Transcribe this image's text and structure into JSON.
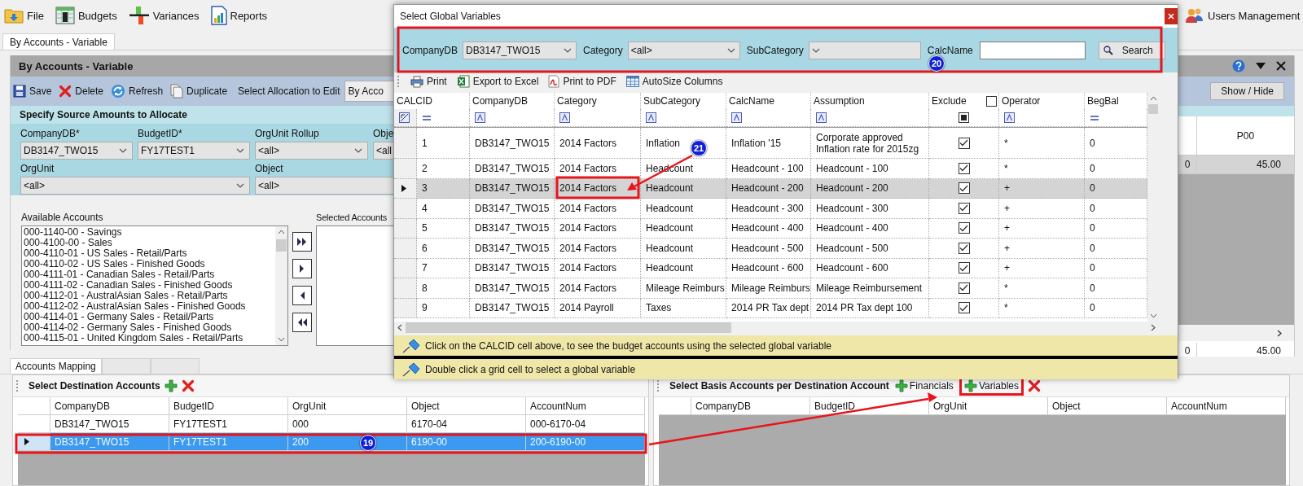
{
  "menu": {
    "items": [
      {
        "label": "File"
      },
      {
        "label": "Budgets"
      },
      {
        "label": "Variances"
      },
      {
        "label": "Reports"
      }
    ],
    "user_button": "Users Management"
  },
  "document_tabs": [
    {
      "label": "By Accounts - Variable",
      "selected": true
    }
  ],
  "panel": {
    "title": "By Accounts - Variable",
    "toolbar": {
      "buttons": [
        {
          "label": "Save"
        },
        {
          "label": "Delete"
        },
        {
          "label": "Refresh"
        },
        {
          "label": "Duplicate"
        }
      ],
      "allocation_label": "Select Allocation to Edit",
      "allocation_value": "By Acco",
      "show_hide": "Show / Hide"
    },
    "source_section": {
      "title": "Specify Source Amounts to Allocate",
      "fields": [
        {
          "label": "CompanyDB*",
          "value": "DB3147_TWO15"
        },
        {
          "label": "BudgetID*",
          "value": "FY17TEST1"
        },
        {
          "label": "OrgUnit Rollup",
          "value": "<all>"
        },
        {
          "label": "Obje",
          "value": "<all"
        },
        {
          "label": "OrgUnit",
          "value": "<all>"
        },
        {
          "label": "Object",
          "value": "<all>"
        }
      ]
    },
    "available_accounts": {
      "label": "Available Accounts",
      "items": [
        "000-1140-00 - Savings",
        "000-4100-00 - Sales",
        "000-4110-01 - US Sales - Retail/Parts",
        "000-4110-02 - US Sales - Finished Goods",
        "000-4111-01 - Canadian Sales - Retail/Parts",
        "000-4111-02 - Canadian Sales - Finished Goods",
        "000-4112-01 - AustralAsian Sales - Retail/Parts",
        "000-4112-02 - AustralAsian Sales - Finished Goods",
        "000-4114-01 - Germany Sales - Retail/Parts",
        "000-4114-02 - Germany Sales - Finished Goods",
        "000-4115-01 - United Kingdom Sales - Retail/Parts"
      ]
    },
    "selected_accounts": {
      "label": "Selected Accounts"
    },
    "amount_grid": {
      "column_header": "P00",
      "rows": [
        {
          "column_1": "0",
          "value": "45.00",
          "selected": true
        }
      ],
      "totals": {
        "column_1": "0",
        "value": "45.00"
      }
    }
  },
  "mapping_tabs": [
    {
      "label": "Accounts Mapping",
      "selected": true
    },
    {
      "selected": false
    },
    {
      "selected": false
    }
  ],
  "destination": {
    "title": "Select Destination Accounts",
    "columns": [
      "CompanyDB",
      "BudgetID",
      "OrgUnit",
      "Object",
      "AccountNum"
    ],
    "rows": [
      {
        "cells": [
          "DB3147_TWO15",
          "FY17TEST1",
          "000",
          "6170-04",
          "000-6170-04"
        ],
        "selected": false
      },
      {
        "cells": [
          "DB3147_TWO15",
          "FY17TEST1",
          "200",
          "6190-00",
          "200-6190-00"
        ],
        "selected": true
      }
    ]
  },
  "basis": {
    "title": "Select Basis Accounts per Destination Account",
    "add_buttons": [
      {
        "label": "Financials"
      },
      {
        "label": "Variables"
      }
    ],
    "columns": [
      "CompanyDB",
      "BudgetID",
      "OrgUnit",
      "Object",
      "AccountNum"
    ]
  },
  "dialog": {
    "title": "Select Global Variables",
    "filters": [
      {
        "label": "CompanyDB",
        "value": "DB3147_TWO15",
        "kind": "dropdown"
      },
      {
        "label": "Category",
        "value": "<all>",
        "kind": "dropdown"
      },
      {
        "label": "SubCategory",
        "kind": "dropdown"
      },
      {
        "label": "CalcName",
        "kind": "text"
      }
    ],
    "search_button": "Search",
    "toolbar": [
      {
        "label": "Print"
      },
      {
        "label": "Export to Excel"
      },
      {
        "label": "Print to PDF"
      },
      {
        "label": "AutoSize Columns"
      }
    ],
    "grid": {
      "columns": [
        {
          "label": "CALCID",
          "kind": "equals"
        },
        {
          "label": "CompanyDB",
          "kind": "text"
        },
        {
          "label": "Category",
          "kind": "text"
        },
        {
          "label": "SubCategory",
          "kind": "text"
        },
        {
          "label": "CalcName",
          "kind": "text"
        },
        {
          "label": "Assumption",
          "kind": "text"
        },
        {
          "label": "Exclude",
          "kind": "check"
        },
        {
          "label": "Operator",
          "kind": "text"
        },
        {
          "label": "BegBal",
          "kind": "equals"
        }
      ],
      "exclude_all_checked": false,
      "rows": [
        {
          "calcid": "1",
          "company_db": "DB3147_TWO15",
          "category": "2014 Factors",
          "subcategory": "Inflation",
          "calc_name": "Inflation '15",
          "assumption": "Corporate approved Inflation rate for 2015zg",
          "exclude": true,
          "operator": "*",
          "beg_bal": "0",
          "selected": false
        },
        {
          "calcid": "2",
          "company_db": "DB3147_TWO15",
          "category": "2014 Factors",
          "subcategory": "Headcount",
          "calc_name": "Headcount - 100",
          "assumption": "Headcount - 100",
          "exclude": true,
          "operator": "*",
          "beg_bal": "0",
          "selected": false
        },
        {
          "calcid": "3",
          "company_db": "DB3147_TWO15",
          "category": "2014 Factors",
          "subcategory": "Headcount",
          "calc_name": "Headcount - 200",
          "assumption": "Headcount - 200",
          "exclude": true,
          "operator": "+",
          "beg_bal": "0",
          "selected": true
        },
        {
          "calcid": "4",
          "company_db": "DB3147_TWO15",
          "category": "2014 Factors",
          "subcategory": "Headcount",
          "calc_name": "Headcount - 300",
          "assumption": "Headcount - 300",
          "exclude": true,
          "operator": "+",
          "beg_bal": "0",
          "selected": false
        },
        {
          "calcid": "5",
          "company_db": "DB3147_TWO15",
          "category": "2014 Factors",
          "subcategory": "Headcount",
          "calc_name": "Headcount - 400",
          "assumption": "Headcount - 400",
          "exclude": true,
          "operator": "+",
          "beg_bal": "0",
          "selected": false
        },
        {
          "calcid": "6",
          "company_db": "DB3147_TWO15",
          "category": "2014 Factors",
          "subcategory": "Headcount",
          "calc_name": "Headcount - 500",
          "assumption": "Headcount - 500",
          "exclude": true,
          "operator": "+",
          "beg_bal": "0",
          "selected": false
        },
        {
          "calcid": "7",
          "company_db": "DB3147_TWO15",
          "category": "2014 Factors",
          "subcategory": "Headcount",
          "calc_name": "Headcount - 600",
          "assumption": "Headcount - 600",
          "exclude": true,
          "operator": "+",
          "beg_bal": "0",
          "selected": false
        },
        {
          "calcid": "8",
          "company_db": "DB3147_TWO15",
          "category": "2014 Factors",
          "subcategory": "Mileage Reimburs",
          "calc_name": "Mileage Reimburs",
          "assumption": "Mileage Reimbursement",
          "exclude": true,
          "operator": "*",
          "beg_bal": "0",
          "selected": false
        },
        {
          "calcid": "9",
          "company_db": "DB3147_TWO15",
          "category": "2014 Payroll",
          "subcategory": "Taxes",
          "calc_name": "2014 PR Tax dept",
          "assumption": "2014 PR Tax dept 100",
          "exclude": true,
          "operator": "*",
          "beg_bal": "0",
          "selected": false
        }
      ]
    },
    "hints": [
      "Click on the CALCID cell above, to see the budget accounts using the selected global variable",
      "Double click a grid cell to select a global variable"
    ]
  },
  "annotations": [
    {
      "label": "20"
    },
    {
      "label": "21"
    },
    {
      "label": "19"
    }
  ]
}
